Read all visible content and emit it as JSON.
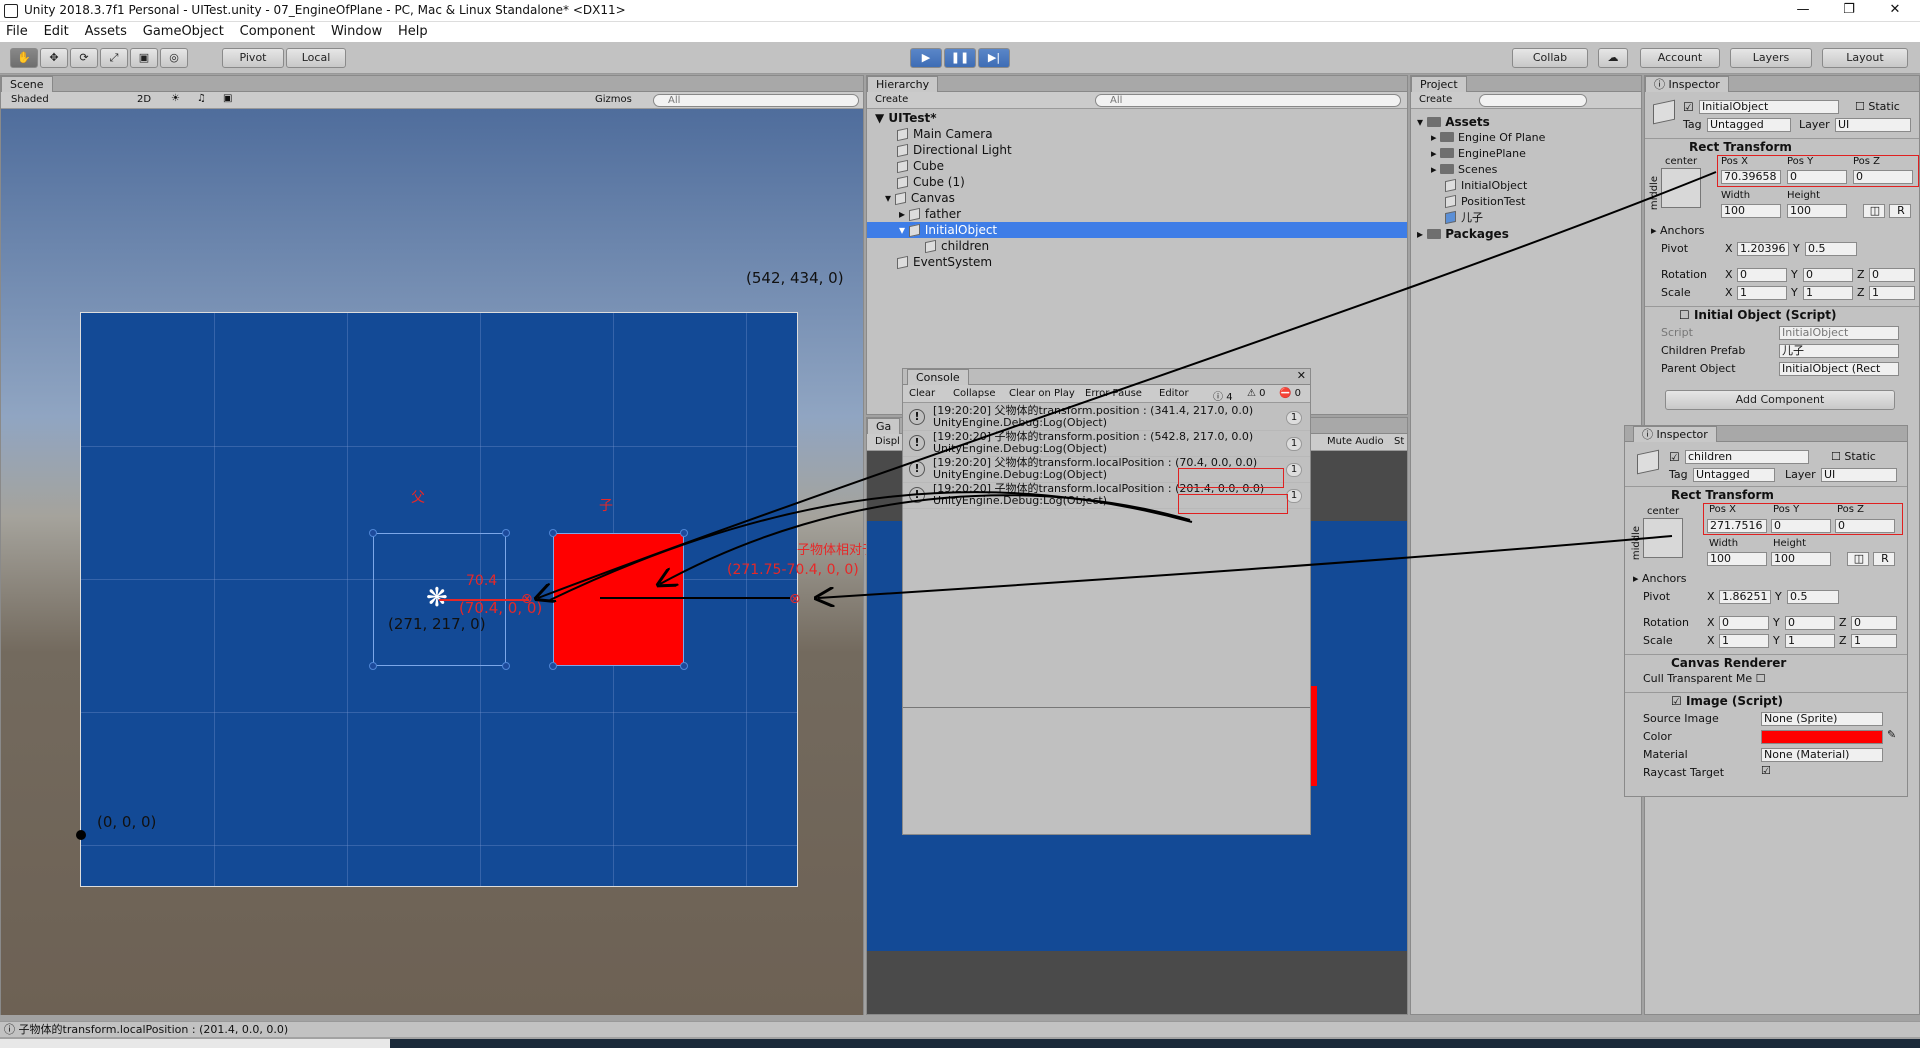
{
  "window": {
    "title": "Unity 2018.3.7f1 Personal - UITest.unity - 07_EngineOfPlane - PC, Mac & Linux Standalone* <DX11>"
  },
  "menu": [
    "File",
    "Edit",
    "Assets",
    "GameObject",
    "Component",
    "Window",
    "Help"
  ],
  "toolbar": {
    "pivot": "Pivot",
    "local": "Local",
    "collab": "Collab",
    "account": "Account",
    "layers": "Layers",
    "layout": "Layout"
  },
  "scene": {
    "tab": "Scene",
    "shaded": "Shaded",
    "mode2d": "2D",
    "gizmos": "Gizmos",
    "search": "All",
    "annotations": {
      "top_right": "(542, 434, 0)",
      "origin": "(0, 0, 0)",
      "father_pos": "(271, 217, 0)",
      "father_label": "父",
      "child_label": "子",
      "offset_value": "70.4",
      "offset_vec": "(70.4, 0, 0)",
      "child_relative": "子物体相对于父物体",
      "child_vec": "(271.75-70.4, 0, 0)"
    }
  },
  "hierarchy": {
    "tab": "Hierarchy",
    "create": "Create",
    "search": "All",
    "scene": "UITest*",
    "items": [
      "Main Camera",
      "Directional Light",
      "Cube",
      "Cube (1)",
      "Canvas",
      "father",
      "InitialObject",
      "children",
      "EventSystem"
    ]
  },
  "project": {
    "tab": "Project",
    "create": "Create",
    "assets": "Assets",
    "items": [
      "Engine Of Plane",
      "EnginePlane",
      "Scenes",
      "InitialObject",
      "PositionTest",
      "儿子"
    ],
    "packages": "Packages"
  },
  "game": {
    "tab": "Ga",
    "display": "Displ",
    "mute": "Mute Audio",
    "stats": "St"
  },
  "console": {
    "tab": "Console",
    "buttons": [
      "Clear",
      "Collapse",
      "Clear on Play",
      "Error Pause",
      "Editor"
    ],
    "counts": {
      "info": "4",
      "warn": "0",
      "error": "0"
    },
    "logs": [
      {
        "line1": "[19:20:20] 父物体的transform.position : (341.4, 217.0, 0.0)",
        "line2": "UnityEngine.Debug:Log(Object)",
        "count": "1"
      },
      {
        "line1": "[19:20:20] 子物体的transform.position : (542.8, 217.0, 0.0)",
        "line2": "UnityEngine.Debug:Log(Object)",
        "count": "1"
      },
      {
        "line1": "[19:20:20] 父物体的transform.localPosition : (70.4, 0.0, 0.0)",
        "line2": "UnityEngine.Debug:Log(Object)",
        "count": "1"
      },
      {
        "line1": "[19:20:20] 子物体的transform.localPosition : (201.4, 0.0, 0.0)",
        "line2": "UnityEngine.Debug:Log(Object)",
        "count": "1"
      }
    ]
  },
  "inspector1": {
    "tab": "Inspector",
    "name": "InitialObject",
    "static": "Static",
    "tag_label": "Tag",
    "tag": "Untagged",
    "layer_label": "Layer",
    "layer": "UI",
    "rect_title": "Rect Transform",
    "anchor_h": "center",
    "anchor_v": "middle",
    "posx_label": "Pos X",
    "posy_label": "Pos Y",
    "posz_label": "Pos Z",
    "posx": "70.39658",
    "posy": "0",
    "posz": "0",
    "width_label": "Width",
    "height_label": "Height",
    "width": "100",
    "height": "100",
    "anchors": "Anchors",
    "pivot": "Pivot",
    "pivot_x": "1.20396",
    "pivot_y": "0.5",
    "rotation": "Rotation",
    "rot": [
      "0",
      "0",
      "0"
    ],
    "scale": "Scale",
    "scl": [
      "1",
      "1",
      "1"
    ],
    "script_title": "Initial Object (Script)",
    "script_label": "Script",
    "script_val": "InitialObject",
    "children_prefab": "Children Prefab",
    "children_prefab_val": "儿子",
    "parent_object": "Parent Object",
    "parent_object_val": "InitialObject (Rect",
    "add_component": "Add Component"
  },
  "inspector2": {
    "tab": "Inspector",
    "name": "children",
    "static": "Static",
    "tag_label": "Tag",
    "tag": "Untagged",
    "layer_label": "Layer",
    "layer": "UI",
    "rect_title": "Rect Transform",
    "anchor_h": "center",
    "anchor_v": "middle",
    "posx_label": "Pos X",
    "posy_label": "Pos Y",
    "posz_label": "Pos Z",
    "posx": "271.7516",
    "posy": "0",
    "posz": "0",
    "width_label": "Width",
    "height_label": "Height",
    "width": "100",
    "height": "100",
    "anchors": "Anchors",
    "pivot": "Pivot",
    "pivot_x": "1.86251",
    "pivot_y": "0.5",
    "rotation": "Rotation",
    "rot": [
      "0",
      "0",
      "0"
    ],
    "scale": "Scale",
    "scl": [
      "1",
      "1",
      "1"
    ],
    "canvas_renderer": "Canvas Renderer",
    "cull": "Cull Transparent Me",
    "image_title": "Image (Script)",
    "source_image": "Source Image",
    "source_image_val": "None (Sprite)",
    "color": "Color",
    "material": "Material",
    "material_val": "None (Material)",
    "raycast": "Raycast Target"
  },
  "statusbar": {
    "text": "子物体的transform.localPosition : (201.4, 0.0, 0.0)"
  },
  "colors": {
    "canvas": "#134a96",
    "red": "#ff0000",
    "selection": "#3e7de7",
    "annotation": "#e62828"
  }
}
